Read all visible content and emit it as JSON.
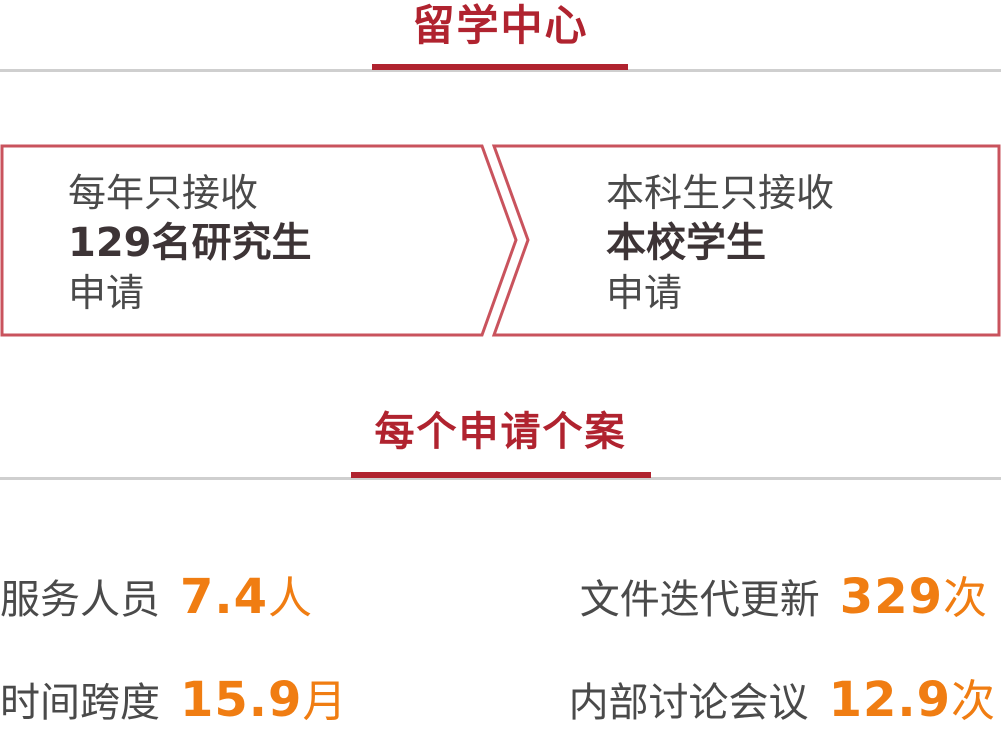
{
  "header1": {
    "title": "留学中心"
  },
  "flow": {
    "left": {
      "line1": "每年只接收",
      "line2": "129名研究生",
      "line3": "申请"
    },
    "right": {
      "line1": "本科生只接收",
      "line2": "本校学生",
      "line3": "申请"
    }
  },
  "header2": {
    "title": "每个申请个案"
  },
  "stats": {
    "staff": {
      "label": "服务人员",
      "value": "7.4",
      "unit": "人"
    },
    "updates": {
      "label": "文件迭代更新",
      "value": "329",
      "unit": "次"
    },
    "timespan": {
      "label": "时间跨度",
      "value": "15.9",
      "unit": "月"
    },
    "meetings": {
      "label": "内部讨论会议",
      "value": "12.9",
      "unit": "次"
    }
  },
  "colors": {
    "accent_red": "#b0232f",
    "value_orange": "#f07d12",
    "text_gray": "#4a4a4a",
    "rule_gray": "#cfcfcf"
  }
}
